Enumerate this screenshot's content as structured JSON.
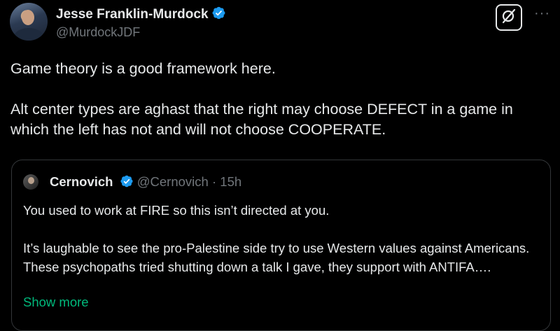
{
  "author": {
    "name": "Jesse Franklin-Murdock",
    "handle": "@MurdockJDF",
    "verified": true,
    "avatar_icon": "profile-photo"
  },
  "actions": {
    "grok_icon": "grok-icon",
    "more_label": "···"
  },
  "tweet": {
    "paragraphs": [
      "Game theory is a good framework here.",
      "Alt center types are aghast that the right may choose DEFECT in a game in which the left has not and will not choose COOPERATE."
    ]
  },
  "quote": {
    "name": "Cernovich",
    "handle": "@Cernovich",
    "separator": "·",
    "time": "15h",
    "verified": true,
    "paragraphs": [
      "You used to work at FIRE so this isn’t directed at you.",
      "It’s laughable to see the pro-Palestine side try to use Western values against Americans. These psychopaths tried shutting down a talk I gave, they support with ANTIFA…."
    ],
    "show_more_label": "Show more"
  },
  "colors": {
    "background": "#000000",
    "text": "#e7e9ea",
    "secondary": "#71767b",
    "verified_blue": "#1d9bf0",
    "link_green": "#00ba7c",
    "border": "#333639"
  }
}
